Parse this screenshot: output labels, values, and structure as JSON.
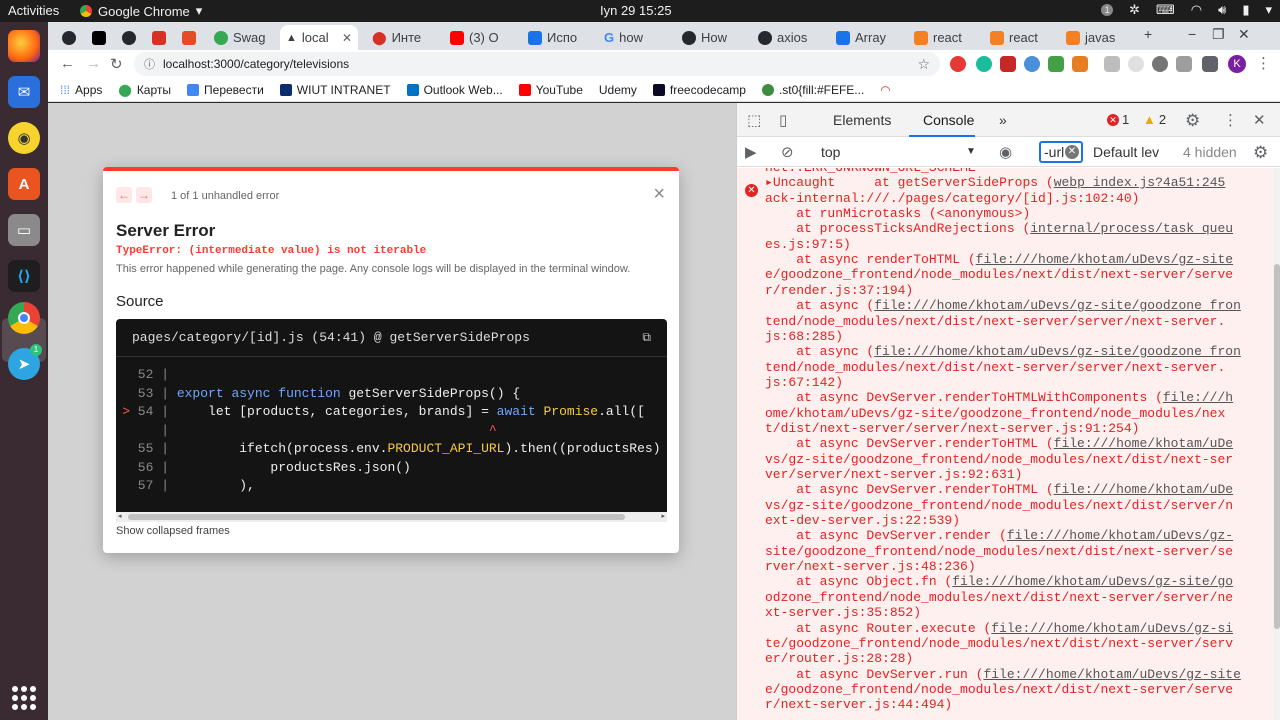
{
  "system": {
    "activities": "Activities",
    "app_name": "Google Chrome",
    "clock": "Іyn 29  15:25",
    "tray_badge": "1"
  },
  "tabs": [
    {
      "label": "",
      "color": "#24292f"
    },
    {
      "label": "",
      "color": "#000000"
    },
    {
      "label": "",
      "color": "#24292f"
    },
    {
      "label": "",
      "color": "#d93025"
    },
    {
      "label": "",
      "color": "#e34c26"
    },
    {
      "label": "Swag",
      "color": "#34a853"
    },
    {
      "label": "local",
      "color": "#000000"
    },
    {
      "label": "Инте",
      "color": "#d93025"
    },
    {
      "label": "(3) O",
      "color": "#ff0000"
    },
    {
      "label": "Испо",
      "color": "#1a73e8"
    },
    {
      "label": "how",
      "color": "#4285f4"
    },
    {
      "label": "How",
      "color": "#24292f"
    },
    {
      "label": "axios",
      "color": "#24292f"
    },
    {
      "label": "Array",
      "color": "#1a73e8"
    },
    {
      "label": "react",
      "color": "#f48024"
    },
    {
      "label": "react",
      "color": "#f48024"
    },
    {
      "label": "javas",
      "color": "#f48024"
    }
  ],
  "toolbar": {
    "url": "localhost:3000/category/televisions",
    "avatar_letter": "K"
  },
  "bookmarks": [
    {
      "label": "Apps",
      "color": "#4285f4"
    },
    {
      "label": "Карты",
      "color": "#34a853"
    },
    {
      "label": "Перевести",
      "color": "#4285f4"
    },
    {
      "label": "WIUT INTRANET",
      "color": "#0a2d6e"
    },
    {
      "label": "Outlook Web...",
      "color": "#0072c6"
    },
    {
      "label": "YouTube",
      "color": "#ff0000"
    },
    {
      "label": "Udemy",
      "color": "#a435f0"
    },
    {
      "label": "freecodecamp",
      "color": "#0a0a23"
    },
    {
      "label": ".st0{fill:#FEFE...",
      "color": "#3c8d40"
    }
  ],
  "overlay": {
    "count": "1 of 1 unhandled error",
    "title": "Server Error",
    "error": "TypeError: (intermediate value) is not iterable",
    "description": "This error happened while generating the page. Any console logs will be displayed in the terminal window.",
    "source_heading": "Source",
    "file": "pages/category/[id].js (54:41) @ getServerSideProps",
    "show_frames": "Show collapsed frames"
  },
  "devtools": {
    "tab_elements": "Elements",
    "tab_console": "Console",
    "error_count": "1",
    "warning_count": "2",
    "context": "top",
    "filter": "-url",
    "level": "Default lev",
    "hidden": "4 hidden",
    "log_lines": [
      "net::ERR_UNKNOWN_URL_SCHEME",
      "▸Uncaught     at getServerSideProps (webp index.js?4a51:245",
      "ack-internal:///./pages/category/[id].js:102:40)",
      "    at runMicrotasks (<anonymous>)",
      "    at processTicksAndRejections (internal/process/task_queu",
      "es.js:97:5)",
      "    at async renderToHTML (file:///home/khotam/uDevs/gz-site",
      "e/goodzone_frontend/node_modules/next/dist/next-server/serve",
      "r/render.js:37:194)",
      "    at async (file:///home/khotam/uDevs/gz-site/goodzone_fron",
      "tend/node_modules/next/dist/next-server/server/next-server.",
      "js:68:285)",
      "    at async (file:///home/khotam/uDevs/gz-site/goodzone_fron",
      "tend/node_modules/next/dist/next-server/server/next-server.",
      "js:67:142)",
      "    at async DevServer.renderToHTMLWithComponents (file:///h",
      "ome/khotam/uDevs/gz-site/goodzone_frontend/node_modules/nex",
      "t/dist/next-server/server/next-server.js:91:254)",
      "    at async DevServer.renderToHTML (file:///home/khotam/uDe",
      "vs/gz-site/goodzone_frontend/node_modules/next/dist/next-ser",
      "ver/server/next-server.js:92:631)",
      "    at async DevServer.renderToHTML (file:///home/khotam/uDe",
      "vs/gz-site/goodzone_frontend/node_modules/next/dist/server/n",
      "ext-dev-server.js:22:539)",
      "    at async DevServer.render (file:///home/khotam/uDevs/gz-",
      "site/goodzone_frontend/node_modules/next/dist/next-server/se",
      "rver/next-server.js:48:236)",
      "    at async Object.fn (file:///home/khotam/uDevs/gz-site/go",
      "odzone_frontend/node_modules/next/dist/next-server/server/ne",
      "xt-server.js:35:852)",
      "    at async Router.execute (file:///home/khotam/uDevs/gz-si",
      "te/goodzone_frontend/node_modules/next/dist/next-server/serv",
      "er/router.js:28:28)",
      "    at async DevServer.run (file:///home/khotam/uDevs/gz-site",
      "e/goodzone_frontend/node_modules/next/dist/next-server/serve",
      "r/next-server.js:44:494)"
    ]
  },
  "code": {
    "lines": [
      {
        "num": "52",
        "marker": "",
        "text": ""
      },
      {
        "num": "53",
        "marker": "",
        "text": "export async function getServerSideProps() {"
      },
      {
        "num": "54",
        "marker": ">",
        "text": "    let [products, categories, brands] = await Promise.all(["
      },
      {
        "num": "",
        "marker": "",
        "text": "                                        ^"
      },
      {
        "num": "55",
        "marker": "",
        "text": "        ifetch(process.env.PRODUCT_API_URL).then((productsRes)"
      },
      {
        "num": "56",
        "marker": "",
        "text": "            productsRes.json()"
      },
      {
        "num": "57",
        "marker": "",
        "text": "        ),"
      }
    ]
  }
}
